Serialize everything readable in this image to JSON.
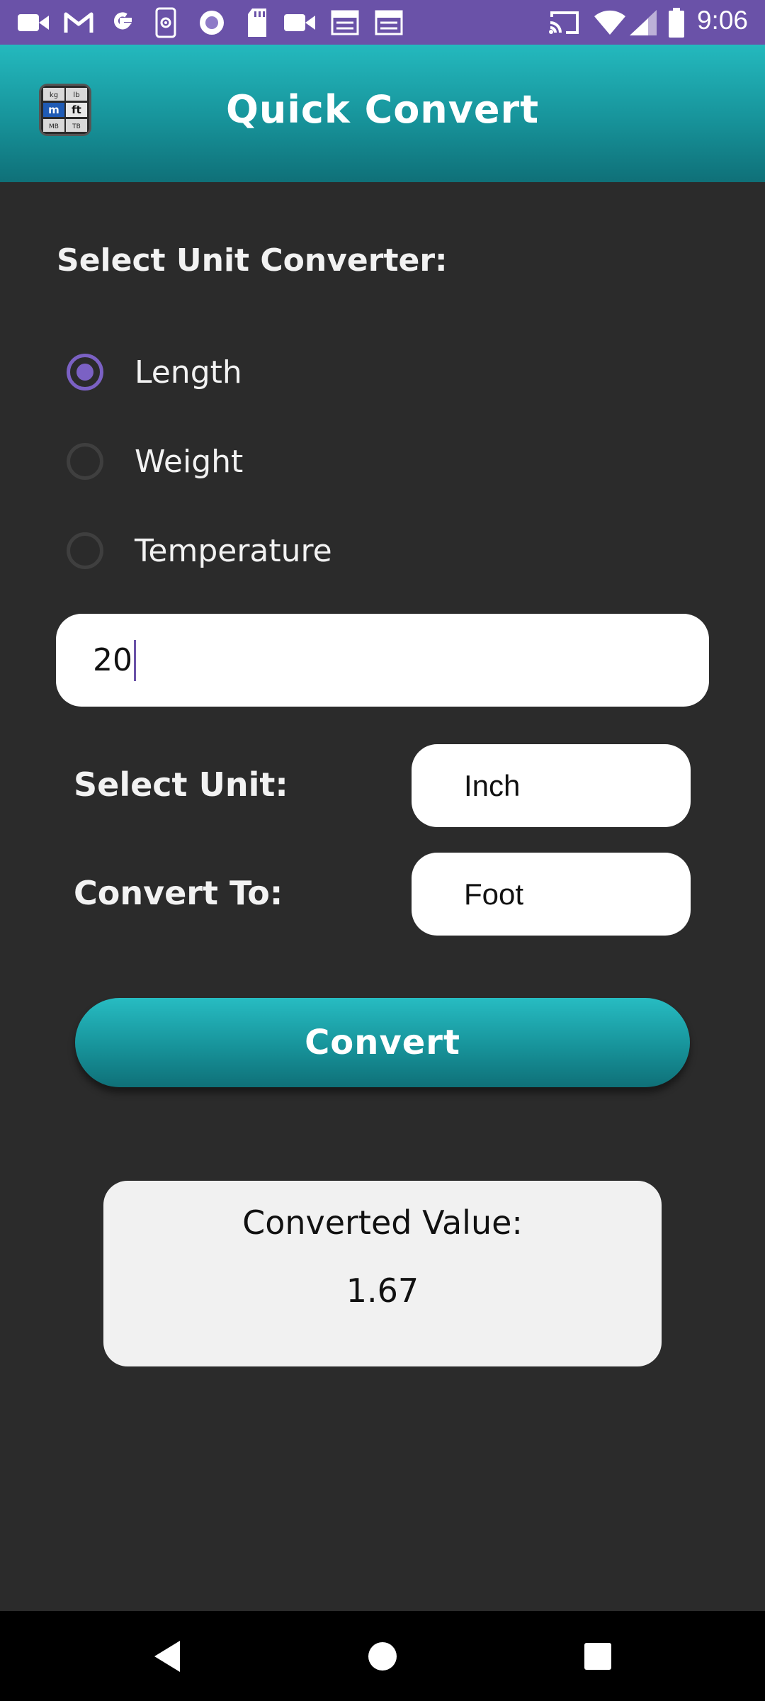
{
  "status_bar": {
    "time": "9:06",
    "left_icons": [
      "video-camera-icon",
      "gmail-icon",
      "google-icon",
      "phone-device-icon",
      "record-icon",
      "sd-card-icon",
      "video-camera-icon",
      "calendar-icon",
      "calendar-icon"
    ],
    "right_icons": [
      "cast-icon",
      "wifi-icon",
      "signal-icon",
      "battery-icon"
    ],
    "background_color": "#6a52a8"
  },
  "app_bar": {
    "title": "Quick Convert",
    "logo_icon": "unit-converter-logo-icon",
    "logo_cells": [
      "kg",
      "lb",
      "m",
      "ft",
      "MB",
      "TB"
    ],
    "gradient_top": "#24b9be",
    "gradient_bottom": "#0f7078"
  },
  "converter_type": {
    "heading": "Select Unit Converter:",
    "options": [
      {
        "label": "Length",
        "checked": true
      },
      {
        "label": "Weight",
        "checked": false
      },
      {
        "label": "Temperature",
        "checked": false
      }
    ],
    "accent_color": "#7b61c4"
  },
  "value_input": {
    "value": "20"
  },
  "from_unit": {
    "label": "Select Unit:",
    "selected": "Inch"
  },
  "to_unit": {
    "label": "Convert To:",
    "selected": "Foot"
  },
  "convert_button": {
    "label": "Convert"
  },
  "result": {
    "label": "Converted Value:",
    "value": "1.67"
  },
  "nav_bar": {
    "buttons": [
      "back-icon",
      "home-icon",
      "recents-icon"
    ]
  }
}
